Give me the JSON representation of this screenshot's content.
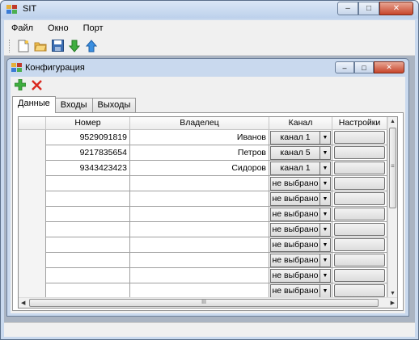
{
  "app": {
    "title": "SIT"
  },
  "window_buttons": {
    "minimize": "–",
    "maximize": "□",
    "close": "✕"
  },
  "menu": [
    {
      "label": "Файл"
    },
    {
      "label": "Окно"
    },
    {
      "label": "Порт"
    }
  ],
  "toolbar": {
    "icons": [
      "new-file-icon",
      "open-folder-icon",
      "save-icon",
      "download-arrow-icon",
      "upload-arrow-icon"
    ]
  },
  "child_window": {
    "title": "Конфигурация",
    "tools": [
      "add-icon",
      "delete-icon"
    ],
    "tabs": [
      {
        "label": "Данные",
        "active": true
      },
      {
        "label": "Входы",
        "active": false
      },
      {
        "label": "Выходы",
        "active": false
      }
    ]
  },
  "grid": {
    "columns": [
      "Номер",
      "Владелец",
      "Канал",
      "Настройки"
    ],
    "rows": [
      {
        "number": "9529091819",
        "owner": "Иванов",
        "channel": "канал 1"
      },
      {
        "number": "9217835654",
        "owner": "Петров",
        "channel": "канал 5"
      },
      {
        "number": "9343423423",
        "owner": "Сидоров",
        "channel": "канал 1"
      },
      {
        "number": "",
        "owner": "",
        "channel": "не выбрано"
      },
      {
        "number": "",
        "owner": "",
        "channel": "не выбрано"
      },
      {
        "number": "",
        "owner": "",
        "channel": "не выбрано"
      },
      {
        "number": "",
        "owner": "",
        "channel": "не выбрано"
      },
      {
        "number": "",
        "owner": "",
        "channel": "не выбрано"
      },
      {
        "number": "",
        "owner": "",
        "channel": "не выбрано"
      },
      {
        "number": "",
        "owner": "",
        "channel": "не выбрано"
      },
      {
        "number": "",
        "owner": "",
        "channel": "не выбрано"
      }
    ],
    "hscroll_grip": "III",
    "vscroll_grip": "≡"
  },
  "colors": {
    "frame": "#c9d9ee",
    "selection": "#3399ff",
    "close_button": "#c7452b"
  }
}
